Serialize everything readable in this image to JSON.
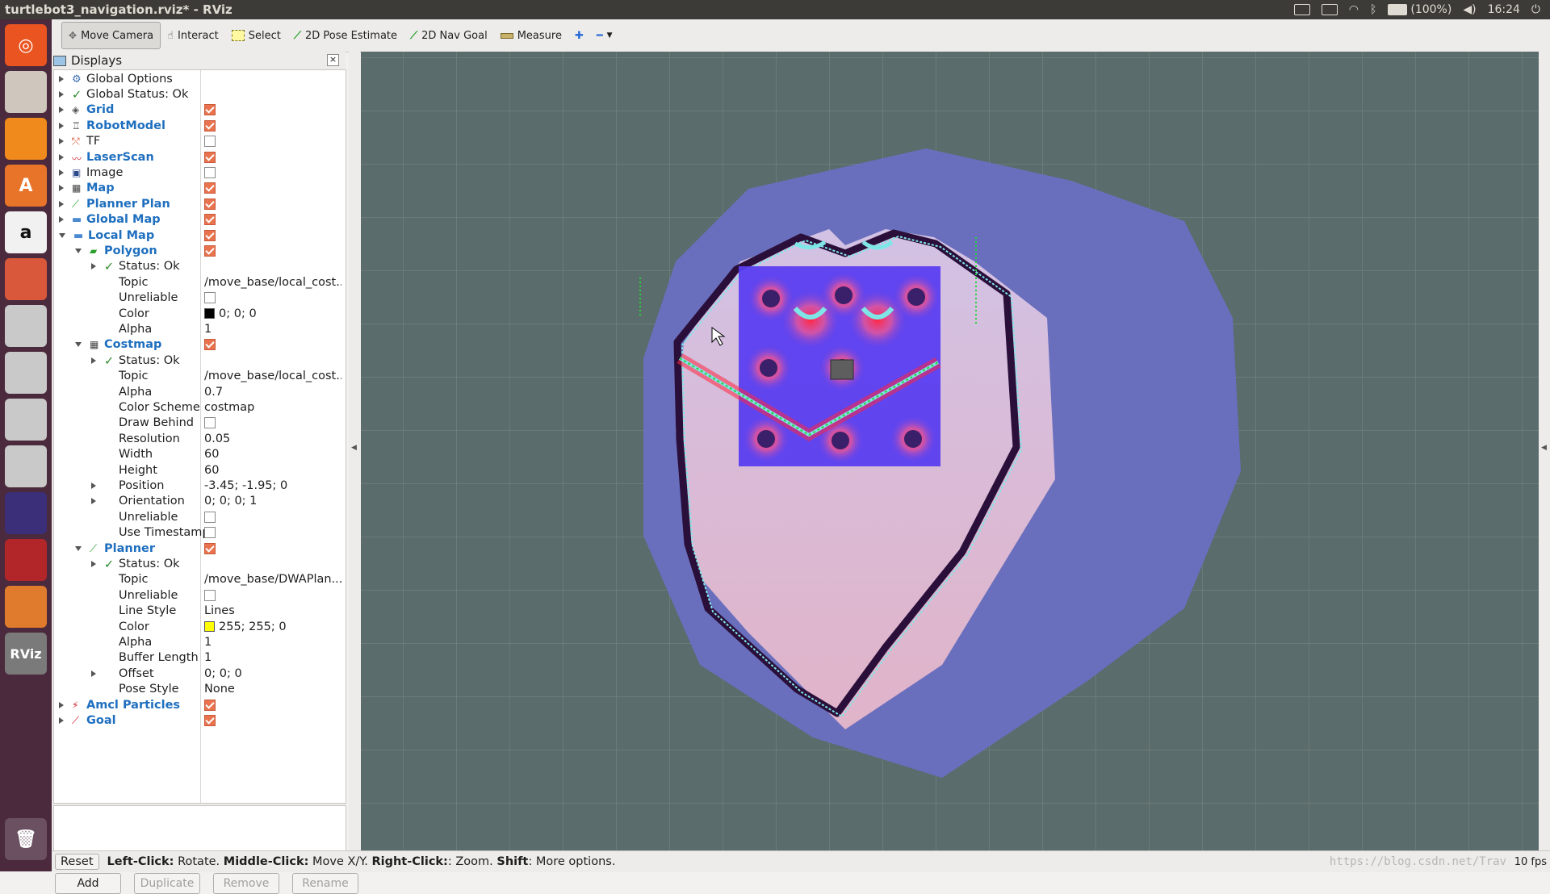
{
  "window": {
    "title": "turtlebot3_navigation.rviz* - RViz"
  },
  "indicators": {
    "battery": "(100%)",
    "clock": "16:24"
  },
  "launcher": {
    "items": [
      {
        "name": "ubuntu-dash-icon",
        "color": "#e95420",
        "glyph": "◎"
      },
      {
        "name": "files-icon",
        "color": "#cfc7bd",
        "glyph": ""
      },
      {
        "name": "firefox-icon",
        "color": "#f08a1c",
        "glyph": ""
      },
      {
        "name": "software-center-icon",
        "color": "#e8742a",
        "glyph": "A"
      },
      {
        "name": "amazon-icon",
        "color": "#f1f1f1",
        "glyph": "a"
      },
      {
        "name": "system-settings-icon",
        "color": "#d9583b",
        "glyph": ""
      },
      {
        "name": "drive-icon-1",
        "color": "#c9c9c9",
        "glyph": ""
      },
      {
        "name": "drive-icon-2",
        "color": "#c9c9c9",
        "glyph": ""
      },
      {
        "name": "drive-icon-3",
        "color": "#c9c9c9",
        "glyph": ""
      },
      {
        "name": "drive-icon-4",
        "color": "#c9c9c9",
        "glyph": ""
      },
      {
        "name": "app-icon-triangle",
        "color": "#3b2f7a",
        "glyph": ""
      },
      {
        "name": "app-icon-red",
        "color": "#b2262a",
        "glyph": ""
      },
      {
        "name": "app-icon-orange",
        "color": "#e07b2e",
        "glyph": ""
      },
      {
        "name": "rviz-icon",
        "color": "#7a7a7a",
        "glyph": "RViz"
      }
    ],
    "trash_glyph": "🗑"
  },
  "toolbar": {
    "move_camera": "Move Camera",
    "interact": "Interact",
    "select": "Select",
    "pose_estimate": "2D Pose Estimate",
    "nav_goal": "2D Nav Goal",
    "measure": "Measure",
    "add_glyph": "✚",
    "minus_glyph": "━"
  },
  "panel": {
    "title": "Displays",
    "close": "×",
    "rows": [
      {
        "level": 0,
        "arrow": "closed",
        "icon": "gear",
        "label": "Global Options",
        "blue": false
      },
      {
        "level": 0,
        "arrow": "closed",
        "icon": "ok",
        "label": "Global Status: Ok",
        "blue": false
      },
      {
        "level": 0,
        "arrow": "closed",
        "icon": "grid",
        "label": "Grid",
        "blue": true,
        "check": true
      },
      {
        "level": 0,
        "arrow": "closed",
        "icon": "robot",
        "label": "RobotModel",
        "blue": true,
        "check": true
      },
      {
        "level": 0,
        "arrow": "closed",
        "icon": "tf",
        "label": "TF",
        "blue": false,
        "check": false
      },
      {
        "level": 0,
        "arrow": "closed",
        "icon": "laser",
        "label": "LaserScan",
        "blue": true,
        "check": true
      },
      {
        "level": 0,
        "arrow": "closed",
        "icon": "image",
        "label": "Image",
        "blue": false,
        "check": false
      },
      {
        "level": 0,
        "arrow": "closed",
        "icon": "map",
        "label": "Map",
        "blue": true,
        "check": true
      },
      {
        "level": 0,
        "arrow": "closed",
        "icon": "path",
        "label": "Planner Plan",
        "blue": true,
        "check": true
      },
      {
        "level": 0,
        "arrow": "closed",
        "icon": "folder",
        "label": "Global Map",
        "blue": true,
        "check": true
      },
      {
        "level": 0,
        "arrow": "open",
        "icon": "folder",
        "label": "Local Map",
        "blue": true,
        "check": true
      },
      {
        "level": 1,
        "arrow": "open",
        "icon": "polygon",
        "label": "Polygon",
        "blue": true,
        "check": true
      },
      {
        "level": 2,
        "arrow": "closed",
        "icon": "ok",
        "label": "Status: Ok",
        "blue": false
      },
      {
        "level": 2,
        "arrow": "none",
        "icon": "",
        "label": "Topic",
        "blue": false,
        "value": "/move_base/local_cost..."
      },
      {
        "level": 2,
        "arrow": "none",
        "icon": "",
        "label": "Unreliable",
        "blue": false,
        "check": false
      },
      {
        "level": 2,
        "arrow": "none",
        "icon": "",
        "label": "Color",
        "blue": false,
        "swatch": "#000000",
        "value": "0; 0; 0"
      },
      {
        "level": 2,
        "arrow": "none",
        "icon": "",
        "label": "Alpha",
        "blue": false,
        "value": "1"
      },
      {
        "level": 1,
        "arrow": "open",
        "icon": "map",
        "label": "Costmap",
        "blue": true,
        "check": true
      },
      {
        "level": 2,
        "arrow": "closed",
        "icon": "ok",
        "label": "Status: Ok",
        "blue": false
      },
      {
        "level": 2,
        "arrow": "none",
        "icon": "",
        "label": "Topic",
        "blue": false,
        "value": "/move_base/local_cost..."
      },
      {
        "level": 2,
        "arrow": "none",
        "icon": "",
        "label": "Alpha",
        "blue": false,
        "value": "0.7"
      },
      {
        "level": 2,
        "arrow": "none",
        "icon": "",
        "label": "Color Scheme",
        "blue": false,
        "value": "costmap"
      },
      {
        "level": 2,
        "arrow": "none",
        "icon": "",
        "label": "Draw Behind",
        "blue": false,
        "check": false
      },
      {
        "level": 2,
        "arrow": "none",
        "icon": "",
        "label": "Resolution",
        "blue": false,
        "value": "0.05"
      },
      {
        "level": 2,
        "arrow": "none",
        "icon": "",
        "label": "Width",
        "blue": false,
        "value": "60"
      },
      {
        "level": 2,
        "arrow": "none",
        "icon": "",
        "label": "Height",
        "blue": false,
        "value": "60"
      },
      {
        "level": 2,
        "arrow": "closed",
        "icon": "",
        "label": "Position",
        "blue": false,
        "value": "-3.45; -1.95; 0"
      },
      {
        "level": 2,
        "arrow": "closed",
        "icon": "",
        "label": "Orientation",
        "blue": false,
        "value": "0; 0; 0; 1"
      },
      {
        "level": 2,
        "arrow": "none",
        "icon": "",
        "label": "Unreliable",
        "blue": false,
        "check": false
      },
      {
        "level": 2,
        "arrow": "none",
        "icon": "",
        "label": "Use Timestamp",
        "blue": false,
        "check": false
      },
      {
        "level": 1,
        "arrow": "open",
        "icon": "path",
        "label": "Planner",
        "blue": true,
        "check": true
      },
      {
        "level": 2,
        "arrow": "closed",
        "icon": "ok",
        "label": "Status: Ok",
        "blue": false
      },
      {
        "level": 2,
        "arrow": "none",
        "icon": "",
        "label": "Topic",
        "blue": false,
        "value": "/move_base/DWAPlan..."
      },
      {
        "level": 2,
        "arrow": "none",
        "icon": "",
        "label": "Unreliable",
        "blue": false,
        "check": false
      },
      {
        "level": 2,
        "arrow": "none",
        "icon": "",
        "label": "Line Style",
        "blue": false,
        "value": "Lines"
      },
      {
        "level": 2,
        "arrow": "none",
        "icon": "",
        "label": "Color",
        "blue": false,
        "swatch": "#ffff00",
        "value": "255; 255; 0"
      },
      {
        "level": 2,
        "arrow": "none",
        "icon": "",
        "label": "Alpha",
        "blue": false,
        "value": "1"
      },
      {
        "level": 2,
        "arrow": "none",
        "icon": "",
        "label": "Buffer Length",
        "blue": false,
        "value": "1"
      },
      {
        "level": 2,
        "arrow": "closed",
        "icon": "",
        "label": "Offset",
        "blue": false,
        "value": "0; 0; 0"
      },
      {
        "level": 2,
        "arrow": "none",
        "icon": "",
        "label": "Pose Style",
        "blue": false,
        "value": "None"
      },
      {
        "level": 0,
        "arrow": "closed",
        "icon": "particles",
        "label": "Amcl Particles",
        "blue": true,
        "check": true
      },
      {
        "level": 0,
        "arrow": "closed",
        "icon": "goal",
        "label": "Goal",
        "blue": true,
        "check": true
      }
    ],
    "buttons": [
      {
        "label": "Add",
        "disabled": false
      },
      {
        "label": "Duplicate",
        "disabled": true
      },
      {
        "label": "Remove",
        "disabled": true
      },
      {
        "label": "Rename",
        "disabled": true
      }
    ]
  },
  "status": {
    "reset": "Reset",
    "hint_parts": [
      {
        "b": "Left-Click:",
        "t": " Rotate. "
      },
      {
        "b": "Middle-Click:",
        "t": " Move X/Y. "
      },
      {
        "b": "Right-Click:",
        "t": ": Zoom. "
      },
      {
        "b": "Shift",
        "t": ": More options."
      }
    ],
    "fps": "10 fps",
    "watermark": "https://blog.csdn.net/Trav"
  },
  "colors": {
    "viewport_bg": "#5a6c6b",
    "inflation_blue": "#6a70c4",
    "inflation_pink": "#f3c9d6",
    "wall": "#2a0f3a",
    "wall_edge": "#7fe6e8",
    "costmap_hot": "#ff2f3f",
    "costmap_blue": "#5a3ef0"
  }
}
